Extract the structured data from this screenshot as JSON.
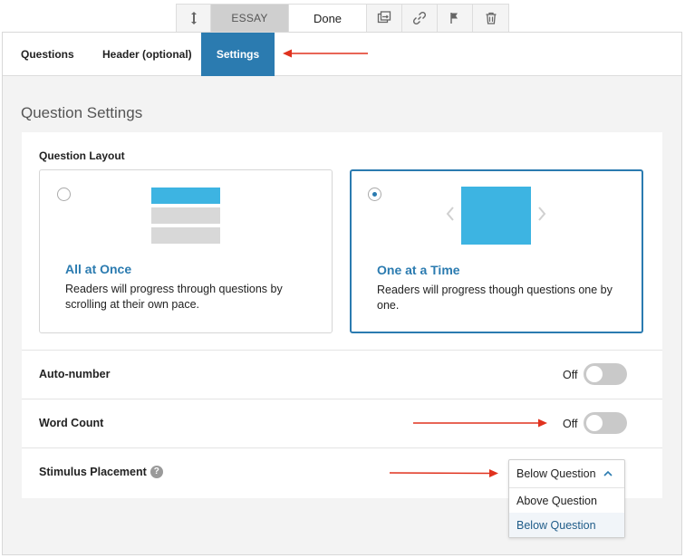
{
  "toolbar": {
    "type_label": "ESSAY",
    "done_label": "Done",
    "icons": [
      "move-vertical-icon",
      "swap-icon",
      "link-icon",
      "flag-icon",
      "trash-icon"
    ]
  },
  "tabs": [
    {
      "label": "Questions",
      "active": false
    },
    {
      "label": "Header (optional)",
      "active": false
    },
    {
      "label": "Settings",
      "active": true
    }
  ],
  "section_title": "Question Settings",
  "layout": {
    "label": "Question Layout",
    "options": [
      {
        "title": "All at Once",
        "description": "Readers will progress through questions by scrolling at their own pace.",
        "selected": false
      },
      {
        "title": "One at a Time",
        "description": "Readers will progress though questions one by one.",
        "selected": true
      }
    ]
  },
  "settings": {
    "auto_number": {
      "label": "Auto-number",
      "state_label": "Off"
    },
    "word_count": {
      "label": "Word Count",
      "state_label": "Off"
    },
    "stimulus": {
      "label": "Stimulus Placement",
      "help": "?",
      "value": "Below Question",
      "options": [
        "Above Question",
        "Below Question"
      ]
    }
  },
  "colors": {
    "accent": "#2b7bb0",
    "illustration_blue": "#3db4e2",
    "annotation_arrow": "#e0321e"
  }
}
